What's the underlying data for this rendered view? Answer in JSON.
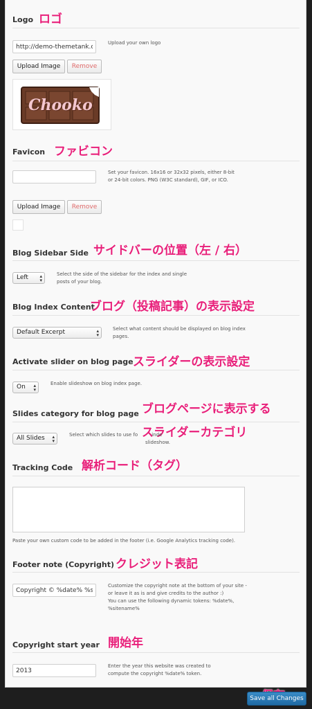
{
  "logo": {
    "title": "Logo",
    "anno": "ロゴ",
    "url_value": "http://demo-themetank.c",
    "desc": "Upload your own logo",
    "upload_label": "Upload Image",
    "remove_label": "Remove",
    "preview_text": "Chooko"
  },
  "favicon": {
    "title": "Favicon",
    "anno": "ファビコン",
    "value": "",
    "desc": "Set your favicon. 16x16 or 32x32 pixels, either 8-bit or 24-bit colors. PNG (W3C standard), GIF, or ICO.",
    "upload_label": "Upload Image",
    "remove_label": "Remove"
  },
  "blog_sidebar": {
    "title": "Blog Sidebar Side",
    "anno": "サイドバーの位置（左 / 右）",
    "value": "Left",
    "desc": "Select the side of the sidebar for the index and single posts of your blog."
  },
  "blog_index": {
    "title": "Blog Index Content",
    "anno": "ブログ（投稿記事）の表示設定",
    "value": "Default Excerpt",
    "desc": "Select what content should be displayed on blog index pages."
  },
  "slider": {
    "title": "Activate slider on blog page",
    "anno": "スライダーの表示設定",
    "value": "On",
    "desc": "Enable slideshow on blog index page."
  },
  "slides_category": {
    "title": "Slides category for blog page",
    "anno1": "ブログページに表示する",
    "anno2": "スライダーカテゴリ",
    "value": "All Slides",
    "desc_line1": "Select which slides to use fo",
    "desc_line1_end": "inde",
    "desc_line2": "slideshow."
  },
  "tracking": {
    "title": "Tracking Code",
    "anno": "解析コード（タグ）",
    "value": "",
    "desc": "Paste your own custom code to be added in the footer (i.e. Google Analytics tracking code)."
  },
  "footer_note": {
    "title": "Footer note (Copyright)",
    "anno": "クレジット表記",
    "value": "Copyright © %date% %sit",
    "desc1": "Customize the copyright note at the bottom of your site - or leave it as is and give credits to the author :)",
    "desc2": "You can use the following dynamic tokens: %date%, %sitename%"
  },
  "copyright_year": {
    "title": "Copyright start year",
    "anno": "開始年",
    "value": "2013",
    "desc": "Enter the year this website was created to compute the copyright %date% token."
  },
  "save": {
    "anno": "保存",
    "label": "Save all Changes"
  }
}
